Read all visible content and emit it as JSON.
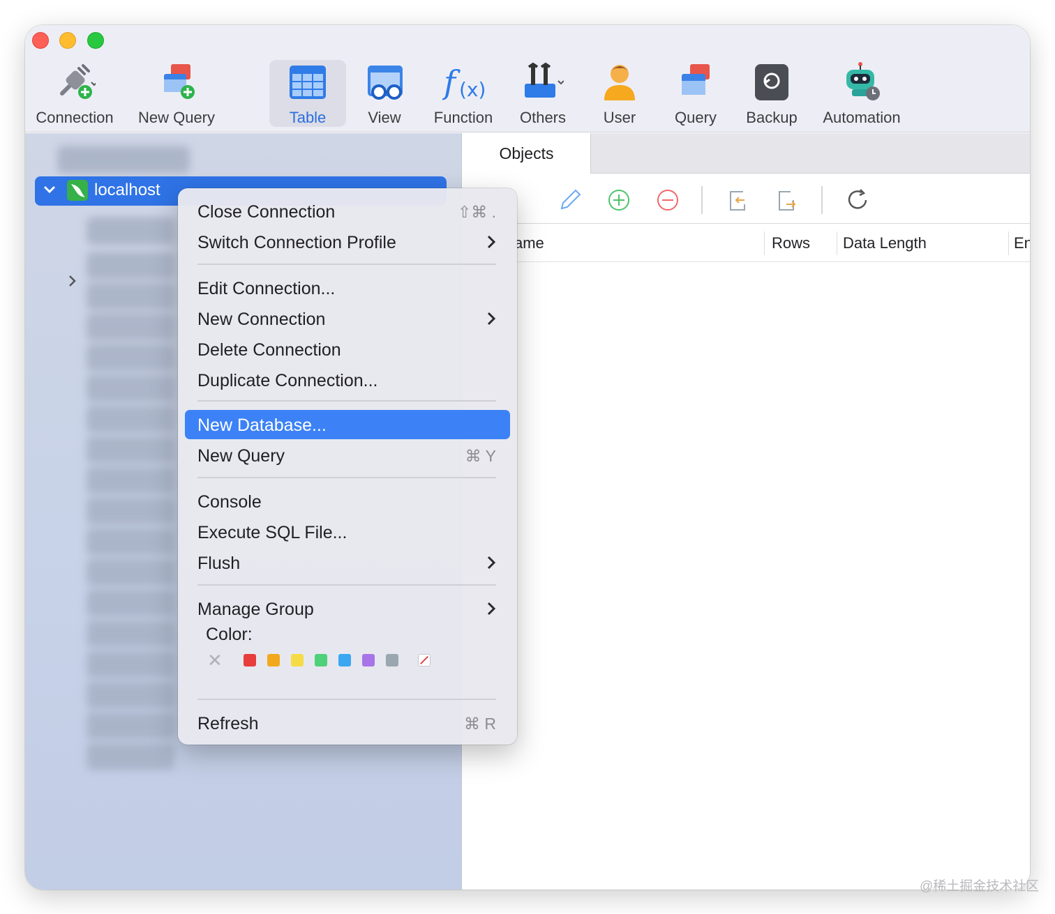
{
  "toolbar": {
    "items": [
      {
        "label": "Connection",
        "icon": "connection-plug-icon"
      },
      {
        "label": "New Query",
        "icon": "new-query-icon"
      },
      {
        "label": "Table",
        "icon": "table-icon",
        "active": true
      },
      {
        "label": "View",
        "icon": "view-icon"
      },
      {
        "label": "Function",
        "icon": "function-icon"
      },
      {
        "label": "Others",
        "icon": "others-tools-icon"
      },
      {
        "label": "User",
        "icon": "user-icon"
      },
      {
        "label": "Query",
        "icon": "query-icon"
      },
      {
        "label": "Backup",
        "icon": "backup-icon"
      },
      {
        "label": "Automation",
        "icon": "automation-robot-icon"
      }
    ]
  },
  "sidebar": {
    "connection_name": "localhost"
  },
  "tabs": {
    "objects": "Objects"
  },
  "table": {
    "columns": [
      "ame",
      "Rows",
      "Data Length",
      "En"
    ]
  },
  "context_menu": {
    "items": [
      {
        "label": "Close Connection",
        "shortcut": "⇧⌘ ."
      },
      {
        "label": "Switch Connection Profile",
        "submenu": true
      },
      {
        "label": "Edit Connection..."
      },
      {
        "label": "New Connection",
        "submenu": true
      },
      {
        "label": "Delete Connection"
      },
      {
        "label": "Duplicate Connection..."
      },
      {
        "label": "New Database...",
        "highlighted": true
      },
      {
        "label": "New Query",
        "shortcut": "⌘ Y"
      },
      {
        "label": "Console"
      },
      {
        "label": "Execute SQL File..."
      },
      {
        "label": "Flush",
        "submenu": true
      },
      {
        "label": "Manage Group",
        "submenu": true
      },
      {
        "label": "Refresh",
        "shortcut": "⌘ R"
      }
    ],
    "color_label": "Color:",
    "colors": [
      "#e83d3d",
      "#f2a81d",
      "#f5dc46",
      "#4fd17a",
      "#3aa7f0",
      "#a774e8",
      "#9aa6b0"
    ]
  },
  "watermark": "@稀土掘金技术社区",
  "accent_color": "#3c82f6"
}
